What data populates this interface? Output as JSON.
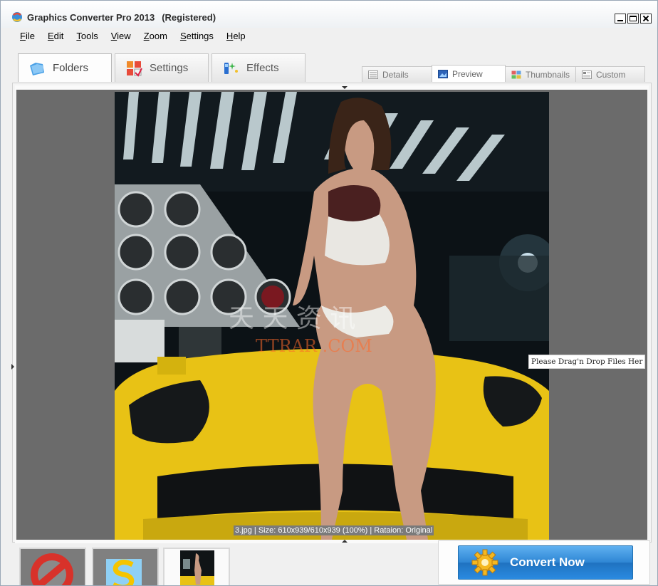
{
  "window": {
    "title": "Graphics Converter Pro 2013",
    "registration": "(Registered)"
  },
  "menu": {
    "items": [
      {
        "pre": "",
        "u": "F",
        "post": "ile"
      },
      {
        "pre": "",
        "u": "E",
        "post": "dit"
      },
      {
        "pre": "",
        "u": "T",
        "post": "ools"
      },
      {
        "pre": "",
        "u": "V",
        "post": "iew"
      },
      {
        "pre": "",
        "u": "Z",
        "post": "oom"
      },
      {
        "pre": "",
        "u": "S",
        "post": "ettings"
      },
      {
        "pre": "",
        "u": "H",
        "post": "elp"
      }
    ]
  },
  "main_tabs": {
    "folders": "Folders",
    "settings": "Settings",
    "effects": "Effects"
  },
  "view_tabs": {
    "details": "Details",
    "preview": "Preview",
    "thumbnails": "Thumbnails",
    "custom": "Custom"
  },
  "preview": {
    "caption": "3.jpg  |  Size: 610x939/610x939 (100%)  |  Rataion: Original",
    "drop_hint": "Please Drag'n Drop Files Her",
    "watermark_cn": "天 天 资 讯",
    "watermark_en": "TTRAR .COM"
  },
  "actions": {
    "convert_label": "Convert Now"
  },
  "colors": {
    "accent_blue": "#2e86d4",
    "preview_bg": "#6b6b6b",
    "car_yellow": "#e8c215"
  }
}
